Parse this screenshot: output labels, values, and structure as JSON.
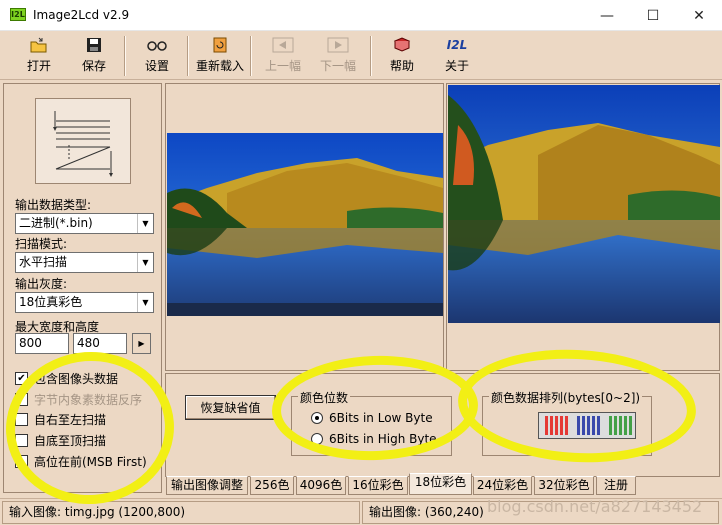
{
  "window": {
    "title": "Image2Lcd v2.9",
    "icon_text": "I2L"
  },
  "toolbar": {
    "open": "打开",
    "save": "保存",
    "settings": "设置",
    "reload": "重新载入",
    "prev": "上一幅",
    "next": "下一幅",
    "help": "帮助",
    "about": "关于",
    "about_icon_text": "I2L"
  },
  "left": {
    "output_type_label": "输出数据类型:",
    "output_type_value": "二进制(*.bin)",
    "scan_mode_label": "扫描模式:",
    "scan_mode_value": "水平扫描",
    "gray_label": "输出灰度:",
    "gray_value": "18位真彩色",
    "maxsize_label": "最大宽度和高度",
    "max_width": "800",
    "max_height": "480",
    "checkboxes": [
      {
        "label": "包含图像头数据",
        "checked": true,
        "disabled": false
      },
      {
        "label": "字节内象素数据反序",
        "checked": false,
        "disabled": true
      },
      {
        "label": "自右至左扫描",
        "checked": false,
        "disabled": false
      },
      {
        "label": "自底至顶扫描",
        "checked": false,
        "disabled": false
      },
      {
        "label": "高位在前(MSB First)",
        "checked": false,
        "disabled": false
      }
    ]
  },
  "settings": {
    "restore_button": "恢复缺省值",
    "color_bits_title": "颜色位数",
    "radio_low": "6Bits in Low Byte",
    "radio_high": "6Bits in High Byte",
    "color_order_title": "颜色数据排列(bytes[0~2])"
  },
  "tabs": [
    "输出图像调整",
    "256色",
    "4096色",
    "16位彩色",
    "18位彩色",
    "24位彩色",
    "32位彩色",
    "注册"
  ],
  "active_tab": "18位彩色",
  "status": {
    "input": "输入图像: timg.jpg (1200,800)",
    "output": "输出图像: (360,240)"
  },
  "watermark": "blog.csdn.net/a827143452",
  "colors": {
    "background": "#ecd8c4",
    "highlight": "#f2ef15",
    "red": "#e53935",
    "blue": "#3949ab",
    "green": "#43a047"
  }
}
